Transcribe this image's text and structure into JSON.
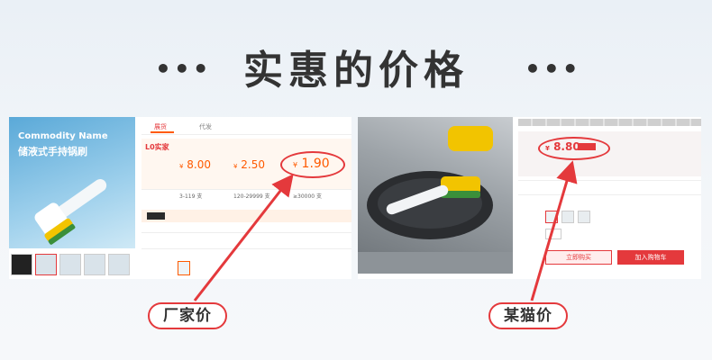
{
  "header": {
    "title": "实惠的价格",
    "dots_left": "•••",
    "dots_right": "•••"
  },
  "factory_listing": {
    "product_name_en": "Commodity Name",
    "product_name_cn": "储液式手持锅刷",
    "tabs": [
      "展货",
      "代发"
    ],
    "store_name": "L0实家",
    "prices": [
      {
        "currency": "¥",
        "value": "8.00"
      },
      {
        "currency": "¥",
        "value": "2.50"
      },
      {
        "currency": "¥",
        "value": "1.90"
      }
    ],
    "quantity_tiers": [
      "3-119 支",
      "120-29999 支",
      "≥30000 支"
    ],
    "colors": {
      "accent": "#ff5a00",
      "highlight": "#e4393c"
    }
  },
  "tmall_listing": {
    "price": {
      "currency": "¥",
      "value": "8.80"
    },
    "buy_button": "立即购买",
    "cart_button": "加入购物车",
    "colors": {
      "accent": "#e4393c"
    }
  },
  "callouts": {
    "factory_label": "厂家价",
    "tmall_label": "某猫价"
  }
}
